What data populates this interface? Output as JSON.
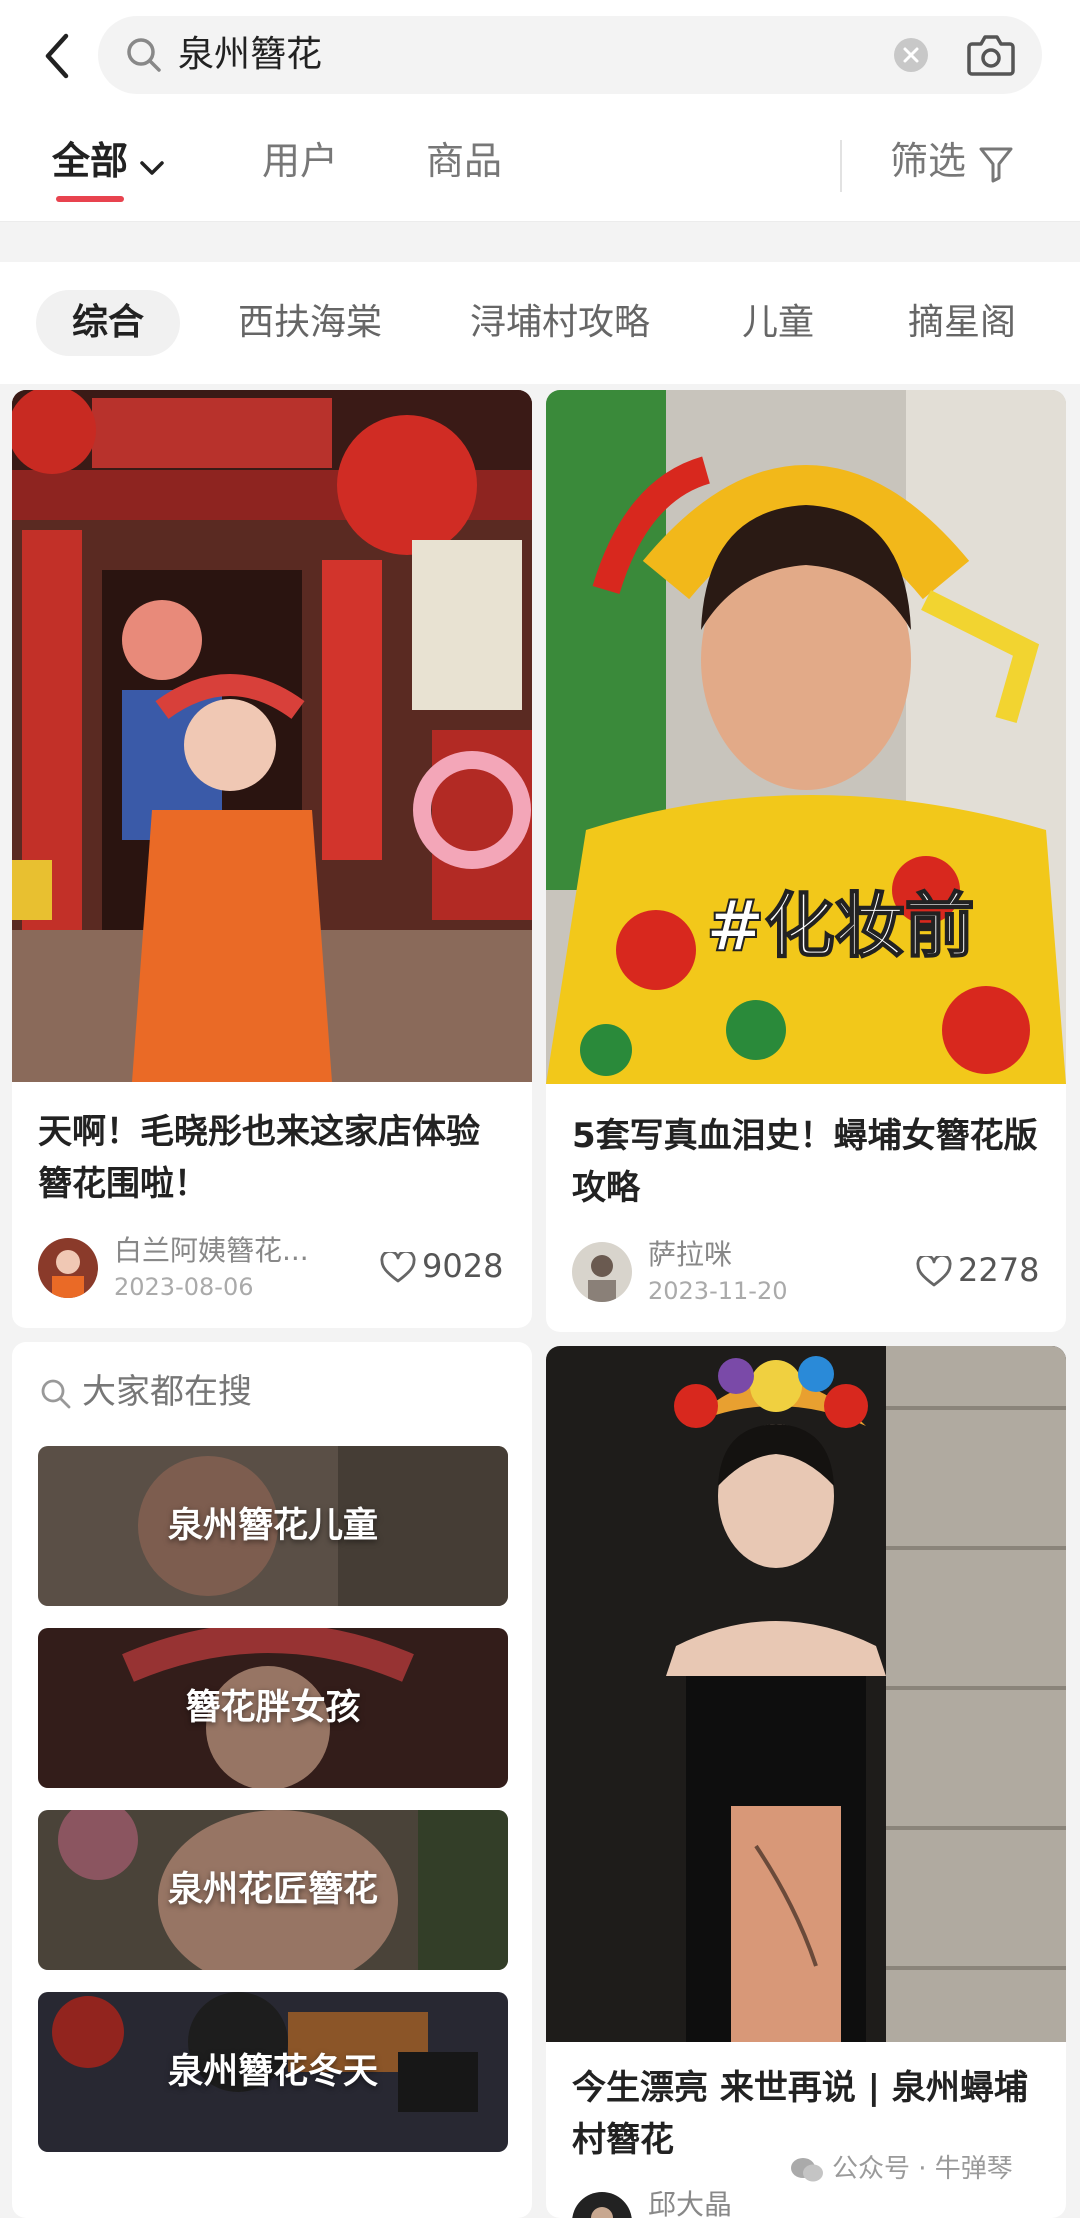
{
  "search": {
    "query": "泉州簪花",
    "icons": [
      "back-arrow-icon",
      "search-icon",
      "clear-icon",
      "camera-icon"
    ]
  },
  "type_tabs": {
    "all": "全部",
    "users": "用户",
    "products": "商品",
    "filter": "筛选"
  },
  "chips": [
    "综合",
    "西扶海棠",
    "浔埔村攻略",
    "儿童",
    "摘星阁"
  ],
  "cards": [
    {
      "title": "天啊！毛晓彤也来这家店体验簪花围啦！",
      "author": "白兰阿姨簪花...",
      "date": "2023-08-06",
      "likes": "9028"
    },
    {
      "title": "5套写真血泪史！蟳埔女簪花版攻略",
      "author": "萨拉咪",
      "date": "2023-11-20",
      "likes": "2278",
      "photo_overlay": "#化妆前"
    },
    {
      "title": "今生漂亮 来世再说 | 泉州蟳埔村簪花",
      "author": "邱大晶"
    }
  ],
  "trending": {
    "heading": "大家都在搜",
    "items": [
      "泉州簪花儿童",
      "簪花胖女孩",
      "泉州花匠簪花",
      "泉州簪花冬天"
    ]
  },
  "watermark": "公众号 · 牛弹琴",
  "colors": {
    "accent": "#e8434f",
    "page_bg": "#f3f3f3"
  }
}
